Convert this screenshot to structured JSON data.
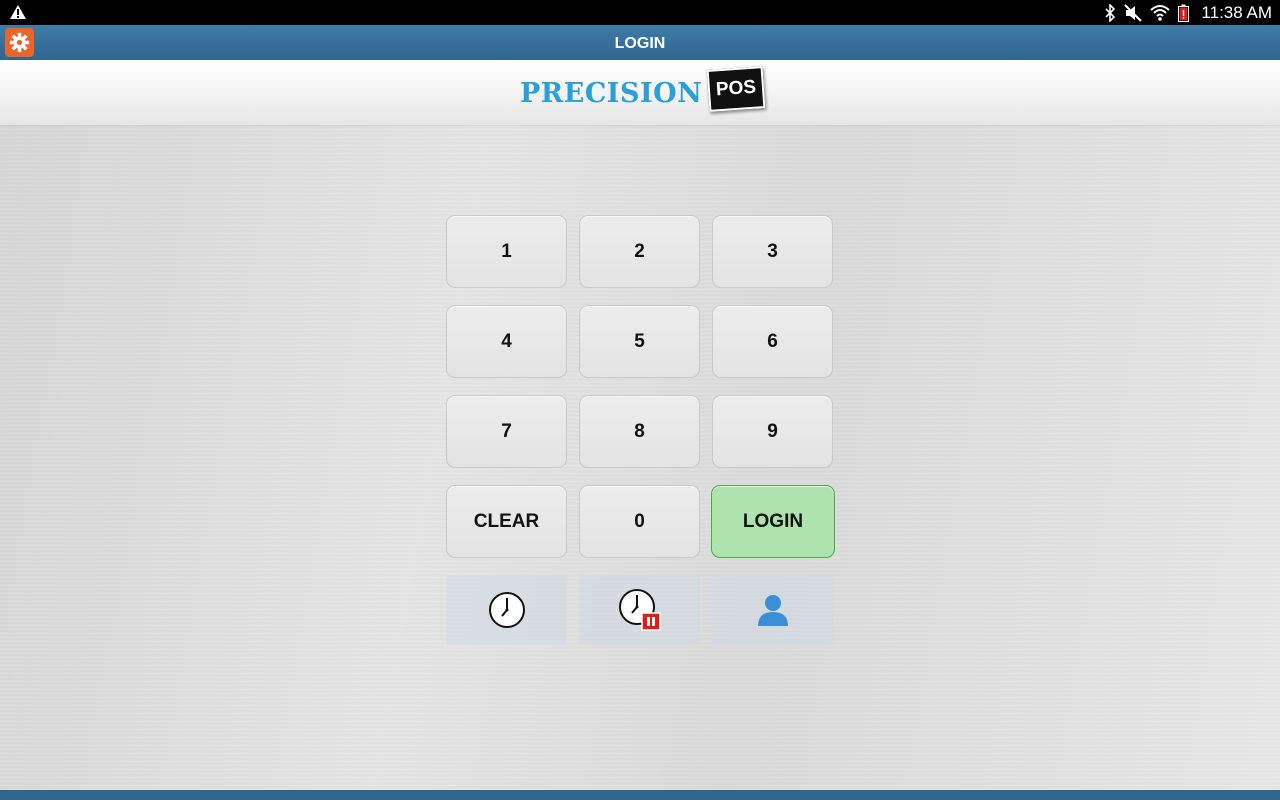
{
  "status_bar": {
    "time": "11:38 AM",
    "icons": [
      "warning-icon",
      "bluetooth-icon",
      "mute-icon",
      "wifi-icon",
      "battery-icon"
    ]
  },
  "title_bar": {
    "title": "LOGIN",
    "settings_icon": "gear-icon",
    "accent": "#e8662a",
    "color": "#36709a"
  },
  "logo": {
    "word": "PRECISION",
    "badge": "POS",
    "word_color": "#2ba0d8"
  },
  "keypad": {
    "keys": [
      "1",
      "2",
      "3",
      "4",
      "5",
      "6",
      "7",
      "8",
      "9",
      "CLEAR",
      "0",
      "LOGIN"
    ],
    "login_color": "#aee3ad"
  },
  "actions": [
    {
      "icon": "clock-icon"
    },
    {
      "icon": "clock-pause-icon",
      "badge_color": "#e11a1a"
    },
    {
      "icon": "user-icon",
      "color": "#3a8fd6"
    }
  ]
}
